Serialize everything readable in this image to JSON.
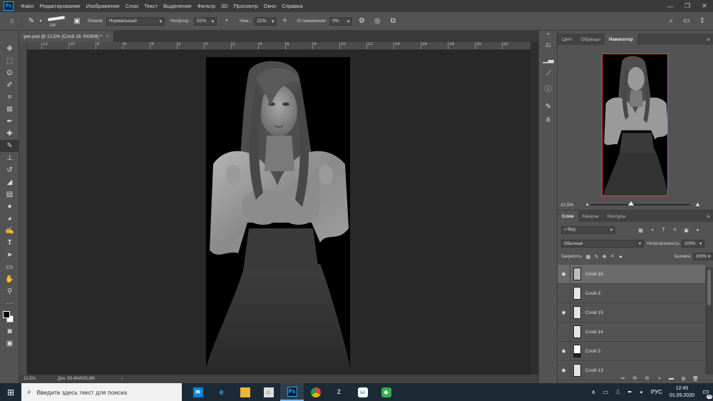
{
  "app": {
    "logo_text": "Ps",
    "menu": [
      "Файл",
      "Редактирование",
      "Изображение",
      "Слои",
      "Текст",
      "Выделение",
      "Фильтр",
      "3D",
      "Просмотр",
      "Окно",
      "Справка"
    ]
  },
  "options_bar": {
    "brush_size": "196",
    "mode_label": "Режим:",
    "mode_value": "Нормальный",
    "opacity_label": "Непрозр.:",
    "opacity_value": "52%",
    "pressure_label": "Наж.:",
    "pressure_value": "22%",
    "smoothing_label": "Сглаживание:",
    "smoothing_value": "0%"
  },
  "document": {
    "tab_title": "yen.psd @ 12,5% (Слой 16, RGB/8) *",
    "close_glyph": "×",
    "zoom": "12,5%",
    "doc_info": "Док: 59,4M/635,8M",
    "arrow": "›"
  },
  "ruler": {
    "labels": [
      "12",
      "10",
      "8",
      "6",
      "4",
      "2",
      "0",
      "2",
      "4",
      "6",
      "8",
      "10",
      "12",
      "14",
      "16",
      "18",
      "20",
      "22"
    ]
  },
  "navigator": {
    "tabs": [
      "Цвет",
      "Образцы",
      "Навигатор"
    ],
    "active_tab": "Навигатор",
    "zoom": "12,5%"
  },
  "layers_panel": {
    "tabs": [
      "Слои",
      "Каналы",
      "Контуры"
    ],
    "active_tab": "Слои",
    "filter_value": "Вид",
    "blend_mode": "Обычные",
    "opacity_label": "Непрозрачность:",
    "opacity_value": "100%",
    "lock_label": "Закрепить:",
    "fill_label": "Заливка:",
    "fill_value": "100%",
    "layers": [
      {
        "name": "Слой 16",
        "visible": true,
        "selected": true
      },
      {
        "name": "Слой 3",
        "visible": false,
        "selected": false
      },
      {
        "name": "Слой 15",
        "visible": true,
        "selected": false
      },
      {
        "name": "Слой 14",
        "visible": false,
        "selected": false
      },
      {
        "name": "Слой 5",
        "visible": true,
        "selected": false
      },
      {
        "name": "Слой 13",
        "visible": true,
        "selected": false
      }
    ],
    "bottom_fx": "fx"
  },
  "taskbar": {
    "search_placeholder": "Введите здесь текст для поиска",
    "lang": "РУС",
    "time": "12:45",
    "date": "01.09.2020",
    "notif_count": "20",
    "ps_label": "Ps",
    "w_label": "ω"
  },
  "colors": {
    "accent": "#31a8ff",
    "nav_frame": "#ff3b3b",
    "canvas_bg": "#282828",
    "panel_bg": "#535353"
  }
}
